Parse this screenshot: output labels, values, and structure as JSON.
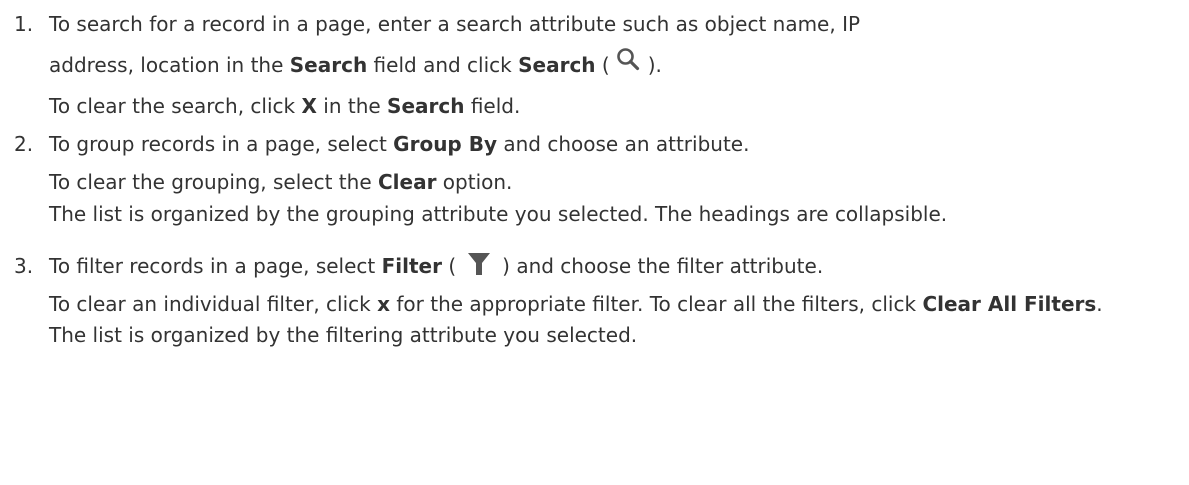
{
  "steps": [
    {
      "number": "1.",
      "line1": "To search for a record in a page, enter a search attribute such as object name, IP",
      "line2_pre": "address, location in the ",
      "line2_b1": "Search",
      "line2_mid": " field and click ",
      "line2_b2": "Search",
      "line2_open": " (",
      "line2_close": ").",
      "line3_pre": "To clear the search, click ",
      "line3_b1": "X",
      "line3_mid": " in the ",
      "line3_b2": "Search",
      "line3_post": " field."
    },
    {
      "number": "2.",
      "line1_pre": "To group records in a page, select ",
      "line1_b": "Group By",
      "line1_post": " and choose an attribute.",
      "line2_pre": "To clear the grouping, select the ",
      "line2_b": "Clear",
      "line2_post": " option.",
      "line3": "The list is organized by the grouping attribute you selected. The headings are collapsible."
    },
    {
      "number": "3.",
      "line1_pre": "To filter records in a page, select ",
      "line1_b": "Filter",
      "line1_open": " (",
      "line1_post": ") and choose the filter attribute.",
      "line2_pre": "To clear an individual filter, click ",
      "line2_b1": "x",
      "line2_post": " for the appropriate filter. To clear all the filters, click ",
      "line2_b2": "Clear All Filters",
      "line2_end": ".",
      "line3": "The list is organized by the filtering attribute you selected."
    }
  ],
  "icons": {
    "search": "search-icon",
    "filter": "filter-icon"
  },
  "colors": {
    "text": "#333333",
    "icon": "#555555"
  }
}
